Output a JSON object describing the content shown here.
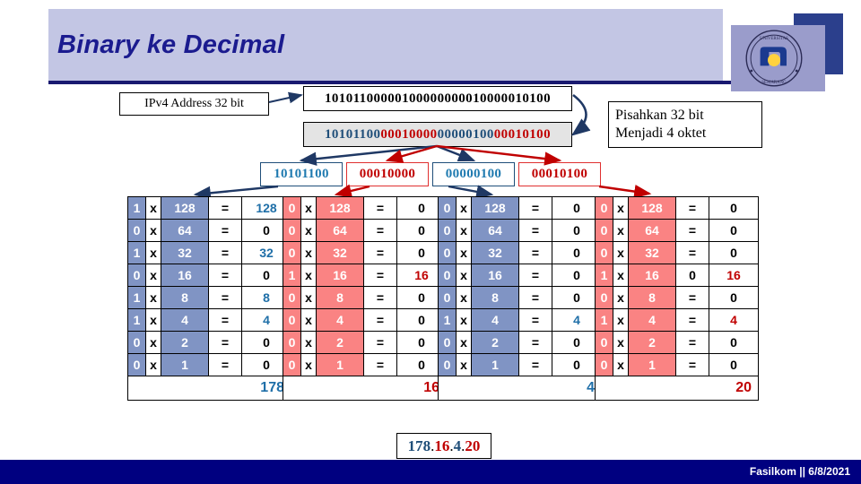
{
  "slide": {
    "title": "Binary ke Decimal",
    "logo": {
      "name": "udinus-logo",
      "ring_text_top": "UNIVERSITAS DIAN NUSWANTORO",
      "ring_text_bottom": "SEMARANG",
      "center_text": "UDINUS"
    },
    "footer": {
      "text": "Fasilkom || 6/8/2021"
    }
  },
  "diagram": {
    "ipv4_label": "IPv4 Address 32 bit",
    "bitstring_plain": "10101100000100000000010000010100",
    "bitstring_segments": [
      {
        "text": "10101100",
        "color": "#1f4e79"
      },
      {
        "text": "00010000",
        "color": "#c00000"
      },
      {
        "text": "00000100",
        "color": "#1f4e79"
      },
      {
        "text": "00010100",
        "color": "#c00000"
      }
    ],
    "note_line1": "Pisahkan 32 bit",
    "note_line2": "Menjadi 4 oktet",
    "octets": [
      {
        "bits": "10101100",
        "color": "blue"
      },
      {
        "bits": "00010000",
        "color": "red"
      },
      {
        "bits": "00000100",
        "color": "blue"
      },
      {
        "bits": "00010100",
        "color": "red"
      }
    ]
  },
  "tables": [
    {
      "color": "blue",
      "accent": "#8094c4",
      "result_color": "#1f6fa8",
      "rows": [
        {
          "bit": "1",
          "op": "x",
          "weight": "128",
          "eq": "=",
          "result": "128"
        },
        {
          "bit": "0",
          "op": "x",
          "weight": "64",
          "eq": "=",
          "result": "0"
        },
        {
          "bit": "1",
          "op": "x",
          "weight": "32",
          "eq": "=",
          "result": "32"
        },
        {
          "bit": "0",
          "op": "x",
          "weight": "16",
          "eq": "=",
          "result": "0"
        },
        {
          "bit": "1",
          "op": "x",
          "weight": "8",
          "eq": "=",
          "result": "8"
        },
        {
          "bit": "1",
          "op": "x",
          "weight": "4",
          "eq": "=",
          "result": "4"
        },
        {
          "bit": "0",
          "op": "x",
          "weight": "2",
          "eq": "=",
          "result": "0"
        },
        {
          "bit": "0",
          "op": "x",
          "weight": "1",
          "eq": "=",
          "result": "0"
        }
      ],
      "total": "178"
    },
    {
      "color": "red",
      "accent": "#fa8383",
      "result_color": "#c00000",
      "rows": [
        {
          "bit": "0",
          "op": "x",
          "weight": "128",
          "eq": "=",
          "result": "0"
        },
        {
          "bit": "0",
          "op": "x",
          "weight": "64",
          "eq": "=",
          "result": "0"
        },
        {
          "bit": "0",
          "op": "x",
          "weight": "32",
          "eq": "=",
          "result": "0"
        },
        {
          "bit": "1",
          "op": "x",
          "weight": "16",
          "eq": "=",
          "result": "16"
        },
        {
          "bit": "0",
          "op": "x",
          "weight": "8",
          "eq": "=",
          "result": "0"
        },
        {
          "bit": "0",
          "op": "x",
          "weight": "4",
          "eq": "=",
          "result": "0"
        },
        {
          "bit": "0",
          "op": "x",
          "weight": "2",
          "eq": "=",
          "result": "0"
        },
        {
          "bit": "0",
          "op": "x",
          "weight": "1",
          "eq": "=",
          "result": "0"
        }
      ],
      "total": "16"
    },
    {
      "color": "blue",
      "accent": "#8094c4",
      "result_color": "#1f6fa8",
      "rows": [
        {
          "bit": "0",
          "op": "x",
          "weight": "128",
          "eq": "=",
          "result": "0"
        },
        {
          "bit": "0",
          "op": "x",
          "weight": "64",
          "eq": "=",
          "result": "0"
        },
        {
          "bit": "0",
          "op": "x",
          "weight": "32",
          "eq": "=",
          "result": "0"
        },
        {
          "bit": "0",
          "op": "x",
          "weight": "16",
          "eq": "=",
          "result": "0"
        },
        {
          "bit": "0",
          "op": "x",
          "weight": "8",
          "eq": "=",
          "result": "0"
        },
        {
          "bit": "1",
          "op": "x",
          "weight": "4",
          "eq": "=",
          "result": "4"
        },
        {
          "bit": "0",
          "op": "x",
          "weight": "2",
          "eq": "=",
          "result": "0"
        },
        {
          "bit": "0",
          "op": "x",
          "weight": "1",
          "eq": "=",
          "result": "0"
        }
      ],
      "total": "4"
    },
    {
      "color": "red",
      "accent": "#fa8383",
      "result_color": "#c00000",
      "rows": [
        {
          "bit": "0",
          "op": "x",
          "weight": "128",
          "eq": "=",
          "result": "0"
        },
        {
          "bit": "0",
          "op": "x",
          "weight": "64",
          "eq": "=",
          "result": "0"
        },
        {
          "bit": "0",
          "op": "x",
          "weight": "32",
          "eq": "=",
          "result": "0"
        },
        {
          "bit": "1",
          "op": "x",
          "weight": "16",
          "eq": "0",
          "result": "16"
        },
        {
          "bit": "0",
          "op": "x",
          "weight": "8",
          "eq": "=",
          "result": "0"
        },
        {
          "bit": "1",
          "op": "x",
          "weight": "4",
          "eq": "=",
          "result": "4"
        },
        {
          "bit": "0",
          "op": "x",
          "weight": "2",
          "eq": "=",
          "result": "0"
        },
        {
          "bit": "0",
          "op": "x",
          "weight": "1",
          "eq": "=",
          "result": "0"
        }
      ],
      "total": "20"
    }
  ],
  "final_answer": {
    "segments": [
      {
        "text": "178",
        "color": "#1f4e79"
      },
      {
        "text": ".",
        "color": "#000000"
      },
      {
        "text": "16",
        "color": "#c00000"
      },
      {
        "text": ".",
        "color": "#000000"
      },
      {
        "text": "4",
        "color": "#1f4e79"
      },
      {
        "text": ".",
        "color": "#000000"
      },
      {
        "text": "20",
        "color": "#c00000"
      }
    ],
    "plain": "178.16.4.20"
  },
  "colors": {
    "banner": "#c3c6e4",
    "title": "#1b1b8f",
    "rule": "#191970",
    "blue_accent": "#8094c4",
    "red_accent": "#fa8383",
    "footer_bar": "#000080"
  }
}
